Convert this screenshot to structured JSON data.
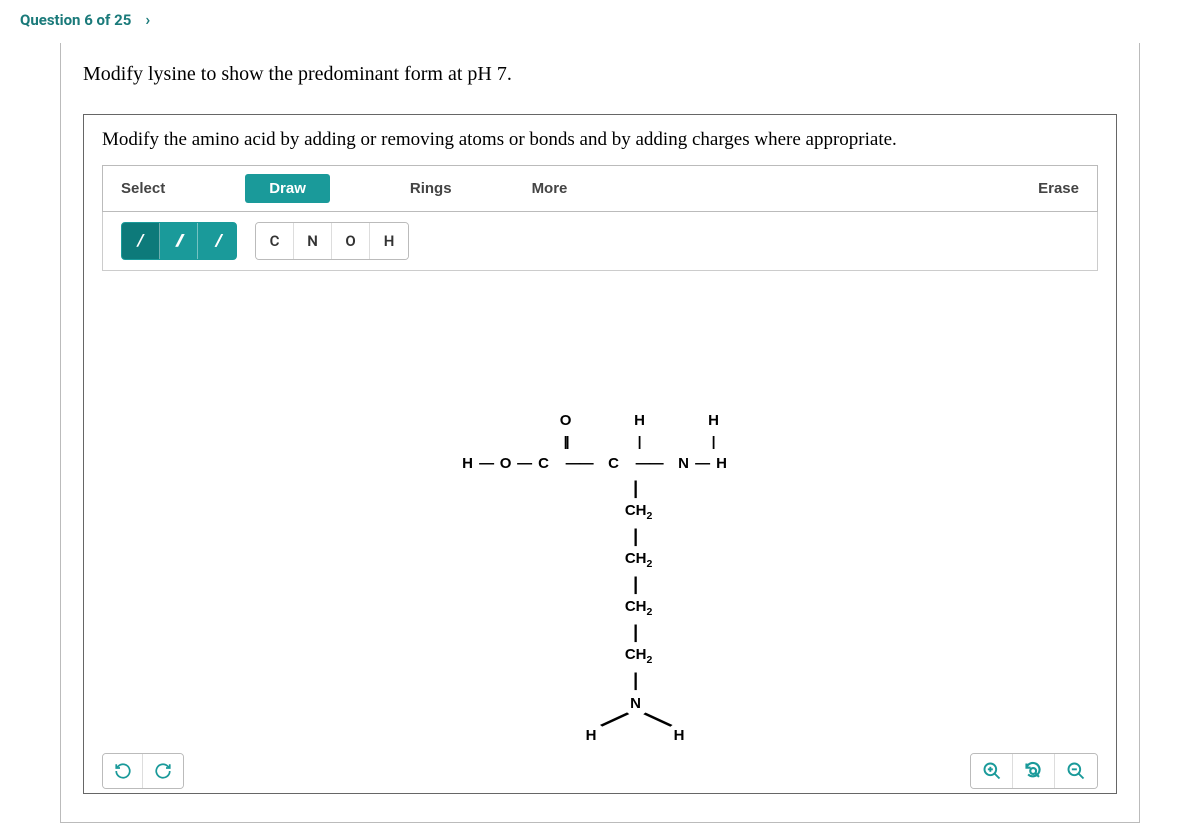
{
  "header": {
    "question_label": "Question 6 of 25"
  },
  "question": "Modify lysine to show the predominant form at pH 7.",
  "instruction": "Modify the amino acid by adding or removing atoms or bonds and by adding charges where appropriate.",
  "toolbar": {
    "select": "Select",
    "draw": "Draw",
    "rings": "Rings",
    "more": "More",
    "erase": "Erase"
  },
  "bonds": {
    "single": "/",
    "double": "//",
    "triple": "///"
  },
  "atoms": {
    "c": "C",
    "n": "N",
    "o": "O",
    "h": "H"
  },
  "molecule": {
    "top_O": "O",
    "top_H1": "H",
    "top_H2": "H",
    "dbond": "||",
    "sbond": "|",
    "backbone_H1": "H",
    "backbone_dash": "—",
    "backbone_O": "O",
    "backbone_C1": "C",
    "backbone_C2": "C",
    "backbone_N": "N",
    "backbone_H2": "H",
    "ch2": "CH",
    "sub2": "2",
    "bottom_N": "N",
    "bottom_H1": "H",
    "bottom_H2": "H"
  }
}
